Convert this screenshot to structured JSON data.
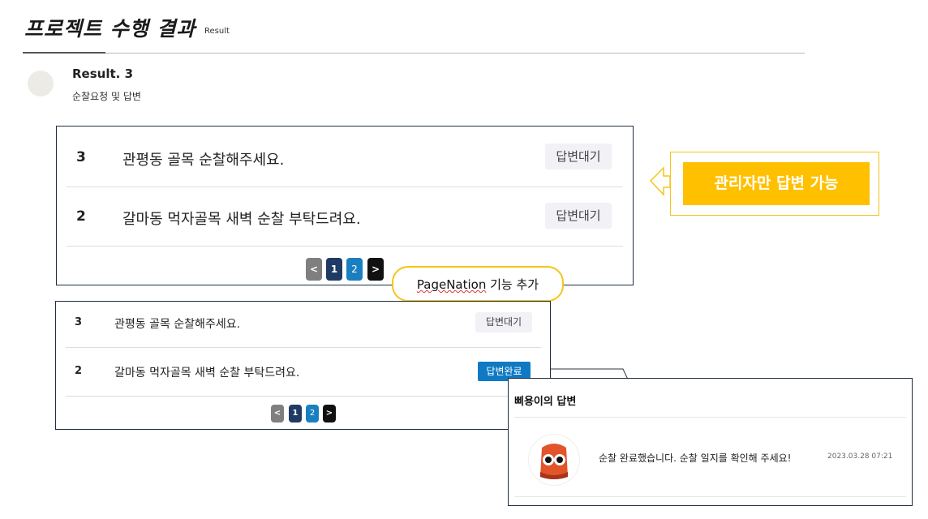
{
  "header": {
    "title": "프로젝트 수행 결과",
    "subtitle": "Result"
  },
  "result": {
    "title": "Result. 3",
    "description": "순찰요청 및 답변"
  },
  "panel_large": {
    "rows": [
      {
        "num": "3",
        "text": "관평동 골목 순찰해주세요.",
        "status": "답변대기"
      },
      {
        "num": "2",
        "text": "갈마동 먹자골목 새벽 순찰 부탁드려요.",
        "status": "답변대기"
      }
    ],
    "pagination": {
      "prev": "<",
      "page1": "1",
      "page2": "2",
      "next": ">"
    }
  },
  "panel_small": {
    "rows": [
      {
        "num": "3",
        "text": "관평동 골목 순찰해주세요.",
        "status": "답변대기"
      },
      {
        "num": "2",
        "text": "갈마동 먹자골목 새벽 순찰 부탁드려요.",
        "status": "답변완료"
      }
    ],
    "pagination": {
      "prev": "<",
      "page1": "1",
      "page2": "2",
      "next": ">"
    }
  },
  "callouts": {
    "admin_only": "관리자만 답변 가능",
    "pagination_word": "PageNation",
    "pagination_rest": " 기능 추가"
  },
  "reply": {
    "heading": "삐용이의 답변",
    "message": "순찰 완료했습니다. 순찰 일지를 확인해 주세요!",
    "date": "2023.03.28 07:21"
  },
  "colors": {
    "accent_yellow": "#ffc000",
    "done_blue": "#0f7ac3",
    "page_active": "#1a7fc1",
    "page_one": "#1f3b63",
    "panel_border": "#1f2d40"
  }
}
